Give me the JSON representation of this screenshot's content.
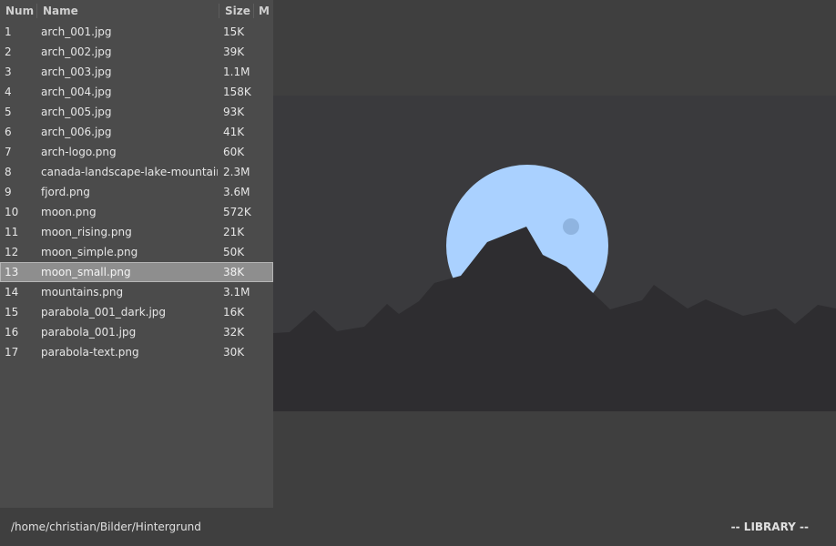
{
  "library": {
    "columns": {
      "num": "Num",
      "name": "Name",
      "size": "Size",
      "mark": "M"
    },
    "selected_index": 12,
    "files": [
      {
        "num": "1",
        "name": "arch_001.jpg",
        "size": "15K"
      },
      {
        "num": "2",
        "name": "arch_002.jpg",
        "size": "39K"
      },
      {
        "num": "3",
        "name": "arch_003.jpg",
        "size": "1.1M"
      },
      {
        "num": "4",
        "name": "arch_004.jpg",
        "size": "158K"
      },
      {
        "num": "5",
        "name": "arch_005.jpg",
        "size": "93K"
      },
      {
        "num": "6",
        "name": "arch_006.jpg",
        "size": "41K"
      },
      {
        "num": "7",
        "name": "arch-logo.png",
        "size": "60K"
      },
      {
        "num": "8",
        "name": "canada-landscape-lake-mountains",
        "size": "2.3M"
      },
      {
        "num": "9",
        "name": "fjord.png",
        "size": "3.6M"
      },
      {
        "num": "10",
        "name": "moon.png",
        "size": "572K"
      },
      {
        "num": "11",
        "name": "moon_rising.png",
        "size": "21K"
      },
      {
        "num": "12",
        "name": "moon_simple.png",
        "size": "50K"
      },
      {
        "num": "13",
        "name": "moon_small.png",
        "size": "38K"
      },
      {
        "num": "14",
        "name": "mountains.png",
        "size": "3.1M"
      },
      {
        "num": "15",
        "name": "parabola_001_dark.jpg",
        "size": "16K"
      },
      {
        "num": "16",
        "name": "parabola_001.jpg",
        "size": "32K"
      },
      {
        "num": "17",
        "name": "parabola-text.png",
        "size": "30K"
      }
    ]
  },
  "preview": {
    "moon_color": "#aad1ff",
    "crater_color": "#8fb4e0",
    "mountain_color": "#2e2d30",
    "background_color": "#3a3a3d"
  },
  "status": {
    "path": "/home/christian/Bilder/Hintergrund",
    "mode": "-- LIBRARY --"
  }
}
